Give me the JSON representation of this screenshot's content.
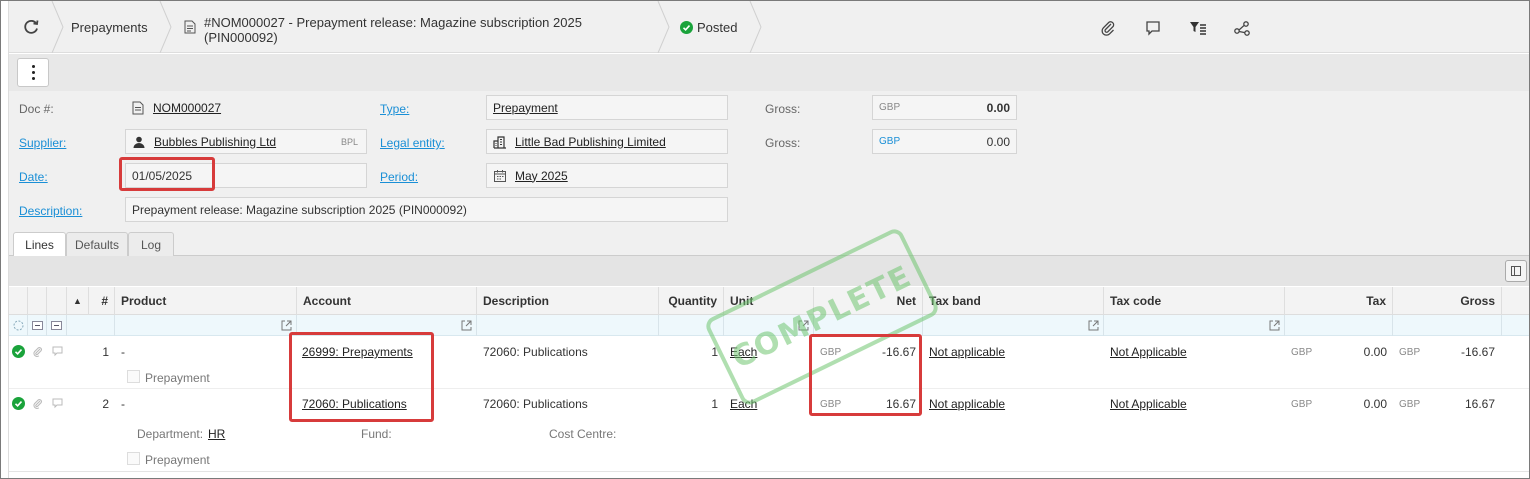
{
  "header": {
    "breadcrumb_1": "Prepayments",
    "doc_title_line1": "#NOM000027 - Prepayment release: Magazine subscription 2025",
    "doc_title_line2": "(PIN000092)",
    "status": "Posted"
  },
  "form": {
    "doc_label": "Doc #:",
    "doc_value": "NOM000027",
    "supplier_label": "Supplier:",
    "supplier_value": "Bubbles Publishing Ltd",
    "supplier_code": "BPL",
    "date_label": "Date:",
    "date_value": "01/05/2025",
    "description_label": "Description:",
    "description_value": "Prepayment release: Magazine subscription 2025 (PIN000092)",
    "type_label": "Type:",
    "type_value": "Prepayment",
    "legal_entity_label": "Legal entity:",
    "legal_entity_value": "Little Bad Publishing Limited",
    "period_label": "Period:",
    "period_value": "May 2025",
    "gross1_label": "Gross:",
    "gross1_currency": "GBP",
    "gross1_value": "0.00",
    "gross2_label": "Gross:",
    "gross2_currency": "GBP",
    "gross2_value": "0.00"
  },
  "tabs": [
    "Lines",
    "Defaults",
    "Log"
  ],
  "grid": {
    "columns": {
      "sort": "▲",
      "num": "#",
      "product": "Product",
      "account": "Account",
      "description": "Description",
      "quantity": "Quantity",
      "unit": "Unit",
      "net": "Net",
      "tax_band": "Tax band",
      "tax_code": "Tax code",
      "tax": "Tax",
      "gross": "Gross"
    },
    "rows": [
      {
        "num": "1",
        "product": "-",
        "account": "26999: Prepayments",
        "description": "72060: Publications",
        "quantity": "1",
        "unit": "Each",
        "net_currency": "GBP",
        "net": "-16.67",
        "tax_band": "Not applicable",
        "tax_code": "Not Applicable",
        "tax_currency": "GBP",
        "tax": "0.00",
        "gross_currency": "GBP",
        "gross": "-16.67",
        "prepayment_label": "Prepayment"
      },
      {
        "num": "2",
        "product": "-",
        "account": "72060: Publications",
        "description": "72060: Publications",
        "quantity": "1",
        "unit": "Each",
        "net_currency": "GBP",
        "net": "16.67",
        "tax_band": "Not applicable",
        "tax_code": "Not Applicable",
        "tax_currency": "GBP",
        "tax": "0.00",
        "gross_currency": "GBP",
        "gross": "16.67",
        "department_label": "Department:",
        "department_value": "HR",
        "fund_label": "Fund:",
        "cost_centre_label": "Cost Centre:",
        "prepayment_label": "Prepayment"
      }
    ]
  },
  "stamp": "COMPLETE",
  "colors": {
    "accent": "#1a8fd6",
    "success": "#1aa33b",
    "highlight": "#d73b3b"
  }
}
